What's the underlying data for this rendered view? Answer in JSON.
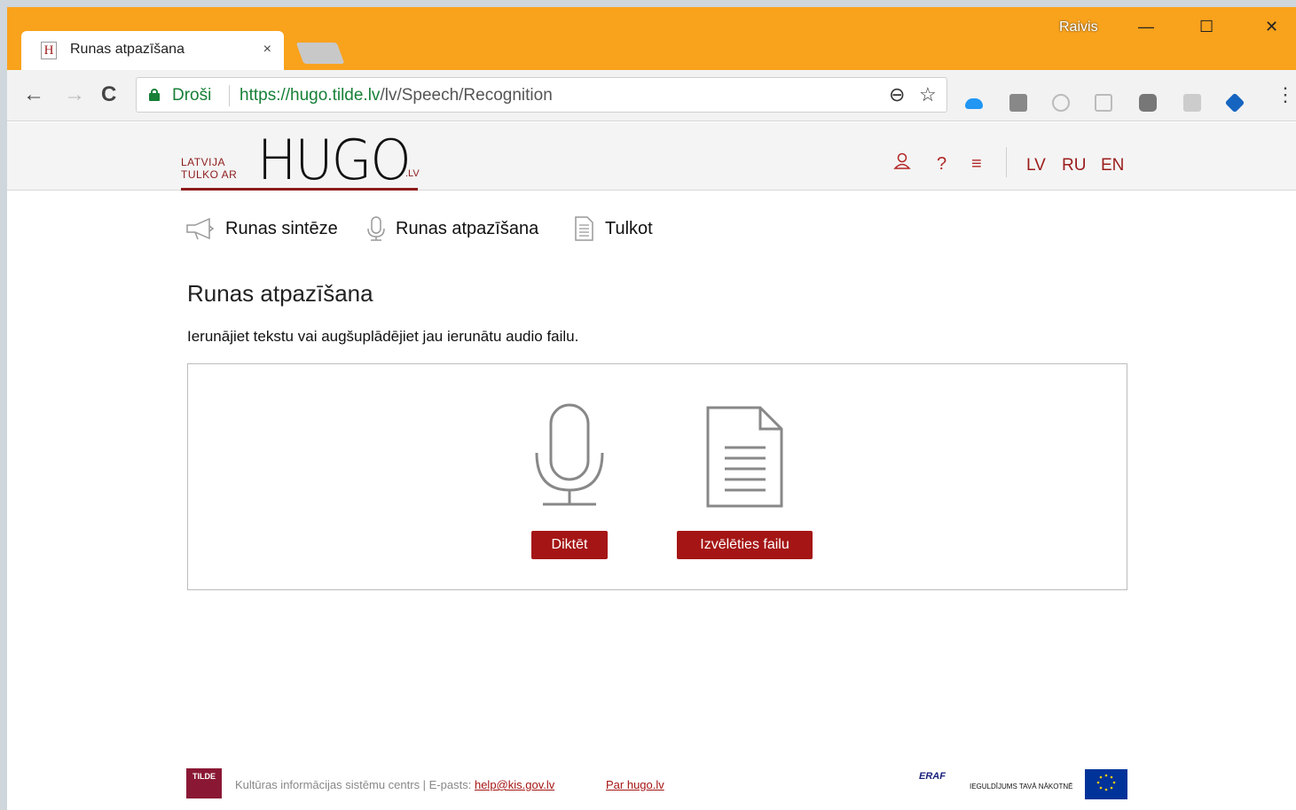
{
  "browser": {
    "tab_title": "Runas atpazīšana",
    "tab_favicon": "H",
    "tab_close": "×",
    "profile_name": "Raivis",
    "win_minimize": "—",
    "win_maximize": "☐",
    "win_close": "✕",
    "nav_back": "←",
    "nav_forward": "→",
    "nav_reload": "C",
    "secure_label": "Droši",
    "url_host": "https://hugo.tilde.lv",
    "url_path": "/lv/Speech/Recognition",
    "zoom_icon": "⊖",
    "star_icon": "☆",
    "menu_icon": "⋮"
  },
  "site_header": {
    "logo_small_line1": "LATVIJA",
    "logo_small_line2": "TULKO AR",
    "logo_big": "HUGO",
    "logo_suffix": ".LV",
    "icons": [
      "user-icon",
      "help-icon",
      "menu-icon"
    ],
    "icon_help": "?",
    "icon_menu": "≡",
    "languages": [
      "LV",
      "RU",
      "EN"
    ]
  },
  "subnav": {
    "items": [
      {
        "label": "Runas sintēze",
        "icon": "megaphone-icon"
      },
      {
        "label": "Runas atpazīšana",
        "icon": "microphone-icon"
      },
      {
        "label": "Tulkot",
        "icon": "document-icon"
      }
    ]
  },
  "main": {
    "title": "Runas atpazīšana",
    "lead": "Ierunājiet tekstu vai augšuplādējiet jau ierunātu audio failu.",
    "dictate_button": "Diktēt",
    "choose_file_button": "Izvēlēties failu"
  },
  "footer": {
    "org_logo_text": "TILDE",
    "org_text": "Kultūras informācijas sistēmu centrs | E-pasts: ",
    "email": "help@kis.gov.lv",
    "about_link": "Par hugo.lv",
    "eraf_label": "ERAF",
    "eraf_slogan": "IEGULDĪJUMS TAVĀ NĀKOTNĒ"
  },
  "colors": {
    "titlebar": "#f9a21c",
    "brand_red": "#a51515",
    "secure_green": "#188038"
  }
}
